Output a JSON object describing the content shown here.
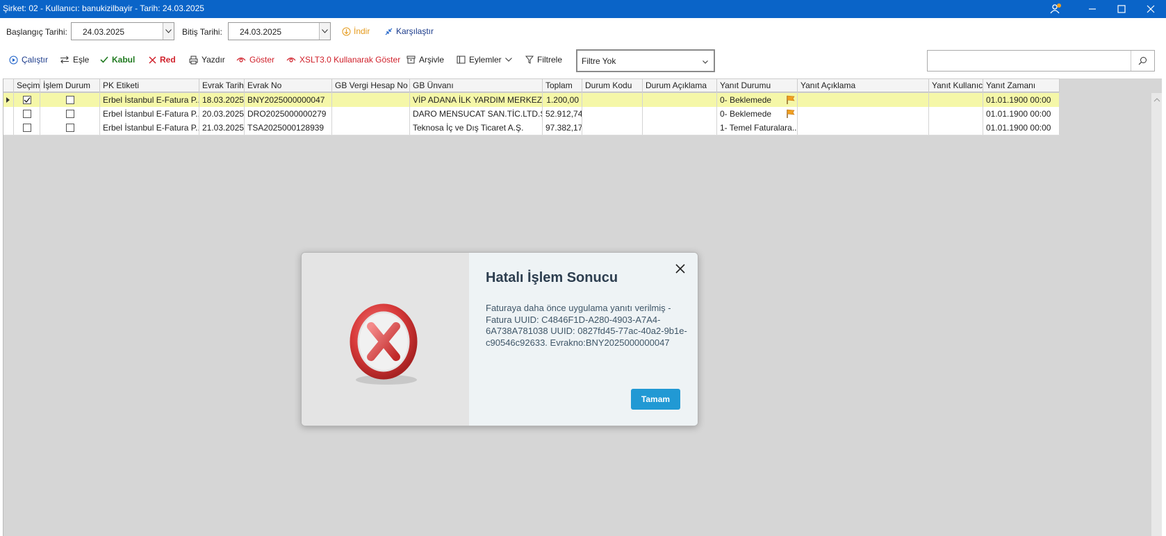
{
  "window": {
    "title": "Şirket: 02 - Kullanıcı: banukizilbayir - Tarih: 24.03.2025",
    "notification_badge": "1"
  },
  "dates": {
    "start_label": "Başlangıç Tarihi:",
    "start_value": "24.03.2025",
    "end_label": "Bitiş Tarihi:",
    "end_value": "24.03.2025",
    "download_label": "İndir",
    "compare_label": "Karşılaştır"
  },
  "toolbar": {
    "run": "Çalıştır",
    "match": "Eşle",
    "accept": "Kabul",
    "reject": "Red",
    "print": "Yazdır",
    "show": "Göster",
    "xslt_show": "XSLT3.0 Kullanarak Göster",
    "archive": "Arşivle",
    "actions": "Eylemler",
    "filter": "Filtrele",
    "filter_value": "Filtre Yok",
    "search_placeholder": ""
  },
  "grid": {
    "headers": [
      "Seçim",
      "İşlem Durum",
      "PK Etiketi",
      "Evrak Tarihi",
      "Evrak No",
      "GB Vergi Hesap No",
      "GB Ünvanı",
      "Toplam",
      "Durum Kodu",
      "Durum Açıklama",
      "Yanıt Durumu",
      "Yanıt Açıklama",
      "Yanıt Kullanıcı",
      "Yanıt Zamanı"
    ],
    "rows": [
      {
        "selected": true,
        "processed": false,
        "pk": "Erbel İstanbul E-Fatura P...",
        "date": "18.03.2025",
        "doc_no": "BNY2025000000047",
        "tax_no": "",
        "title": "VİP ADANA İLK YARDIM MERKEZİ",
        "total": "1.200,00",
        "status_code": "",
        "status_desc": "",
        "reply_status": "0- Beklemede",
        "reply_desc": "",
        "reply_user": "",
        "reply_time": "01.01.1900 00:00",
        "flag": true
      },
      {
        "selected": false,
        "processed": false,
        "pk": "Erbel İstanbul E-Fatura P...",
        "date": "20.03.2025",
        "doc_no": "DRO2025000000279",
        "tax_no": "",
        "title": "DARO MENSUCAT SAN.TİC.LTD.ŞTİ.",
        "total": "52.912,74",
        "status_code": "",
        "status_desc": "",
        "reply_status": "0- Beklemede",
        "reply_desc": "",
        "reply_user": "",
        "reply_time": "01.01.1900 00:00",
        "flag": true
      },
      {
        "selected": false,
        "processed": false,
        "pk": "Erbel İstanbul E-Fatura P...",
        "date": "21.03.2025",
        "doc_no": "TSA2025000128939",
        "tax_no": "",
        "title": "Teknosa İç ve Dış Ticaret A.Ş.",
        "total": "97.382,17",
        "status_code": "",
        "status_desc": "",
        "reply_status": "1- Temel Faturalara...",
        "reply_desc": "",
        "reply_user": "",
        "reply_time": "01.01.1900 00:00",
        "flag": false
      }
    ]
  },
  "dialog": {
    "title": "Hatalı İşlem Sonucu",
    "message": "Faturaya daha önce uygulama yanıtı verilmiş - Fatura UUID: C4846F1D-A280-4903-A7A4-6A738A781038 UUID: 0827fd45-77ac-40a2-9b1e-c90546c92633. Evrakno:BNY2025000000047",
    "ok_label": "Tamam"
  },
  "colors": {
    "titlebar": "#0a64c8",
    "selected_row": "#f5f7a8",
    "accept_green": "#1f7a1f",
    "reject_red": "#d0202a",
    "ok_button": "#2199d4"
  }
}
